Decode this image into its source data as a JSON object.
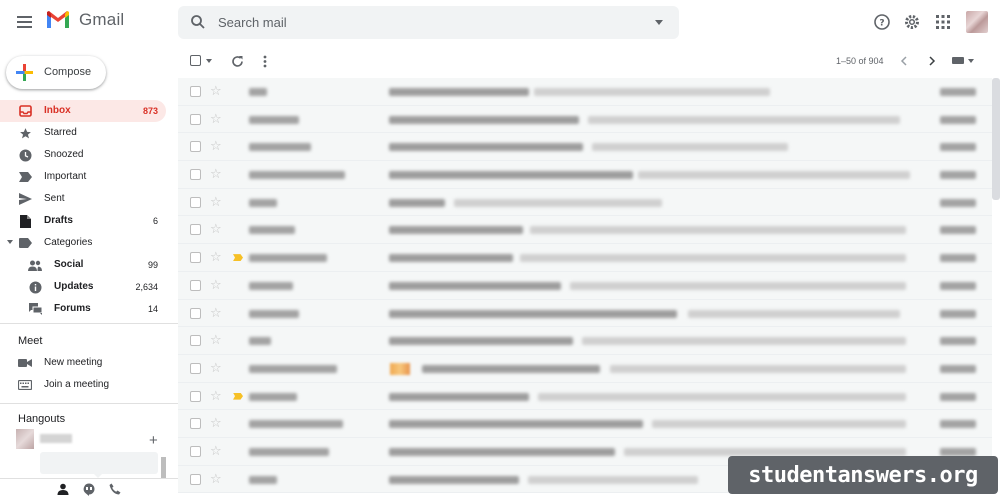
{
  "app": {
    "name": "Gmail"
  },
  "header": {
    "search_placeholder": "Search mail",
    "icons": [
      "menu-icon",
      "help-icon",
      "settings-icon",
      "apps-grid-icon",
      "account-avatar"
    ]
  },
  "compose": {
    "label": "Compose"
  },
  "sidebar": {
    "items": [
      {
        "label": "Inbox",
        "count": "873",
        "icon": "inbox-icon",
        "active": true
      },
      {
        "label": "Starred",
        "count": "",
        "icon": "star-icon"
      },
      {
        "label": "Snoozed",
        "count": "",
        "icon": "clock-icon"
      },
      {
        "label": "Important",
        "count": "",
        "icon": "important-icon"
      },
      {
        "label": "Sent",
        "count": "",
        "icon": "send-icon"
      },
      {
        "label": "Drafts",
        "count": "6",
        "icon": "draft-icon",
        "bold": true
      },
      {
        "label": "Categories",
        "count": "",
        "icon": "label-icon"
      },
      {
        "label": "Social",
        "count": "99",
        "icon": "people-icon"
      },
      {
        "label": "Updates",
        "count": "2,634",
        "icon": "info-icon"
      },
      {
        "label": "Forums",
        "count": "14",
        "icon": "forum-icon"
      }
    ]
  },
  "meet": {
    "title": "Meet",
    "items": [
      {
        "label": "New meeting",
        "icon": "video-icon"
      },
      {
        "label": "Join a meeting",
        "icon": "keyboard-icon"
      }
    ]
  },
  "hangouts": {
    "title": "Hangouts"
  },
  "toolbar": {
    "pagination": "1–50 of 904"
  },
  "colors": {
    "accent_red": "#d93025",
    "active_bg": "#fce8e6",
    "important_yellow": "#f6c026"
  },
  "watermark": {
    "text": "studentanswers.org"
  }
}
